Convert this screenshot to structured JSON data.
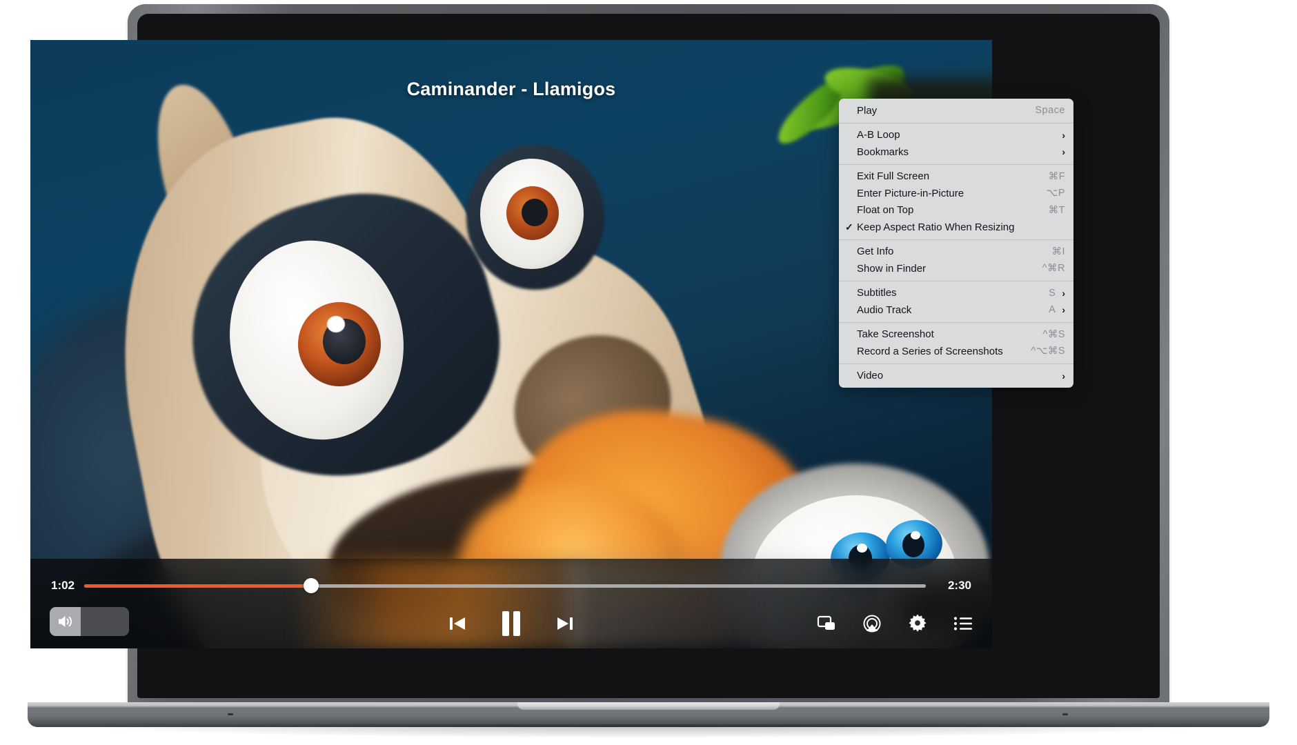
{
  "player": {
    "video_title": "Caminander - Llamigos",
    "current_time": "1:02",
    "duration": "2:30",
    "progress_percent": 27,
    "volume_percent": 39,
    "accent_color": "#f05a28",
    "controls": {
      "volume_icon": "speaker-wave-icon",
      "previous_label": "Previous",
      "play_pause_label": "Pause",
      "next_label": "Next",
      "pip_label": "Picture in Picture",
      "airplay_label": "AirPlay",
      "settings_label": "Settings",
      "playlist_label": "Playlist"
    }
  },
  "context_menu": {
    "groups": [
      [
        {
          "label": "Play",
          "shortcut": "Space",
          "submenu": false,
          "checked": false
        }
      ],
      [
        {
          "label": "A-B Loop",
          "shortcut": "",
          "submenu": true,
          "checked": false
        },
        {
          "label": "Bookmarks",
          "shortcut": "",
          "submenu": true,
          "checked": false
        }
      ],
      [
        {
          "label": "Exit Full Screen",
          "shortcut": "⌘F",
          "submenu": false,
          "checked": false
        },
        {
          "label": "Enter Picture-in-Picture",
          "shortcut": "⌥P",
          "submenu": false,
          "checked": false
        },
        {
          "label": "Float on Top",
          "shortcut": "⌘T",
          "submenu": false,
          "checked": false
        },
        {
          "label": "Keep Aspect Ratio When Resizing",
          "shortcut": "",
          "submenu": false,
          "checked": true
        }
      ],
      [
        {
          "label": "Get Info",
          "shortcut": "⌘I",
          "submenu": false,
          "checked": false
        },
        {
          "label": "Show in Finder",
          "shortcut": "^⌘R",
          "submenu": false,
          "checked": false
        }
      ],
      [
        {
          "label": "Subtitles",
          "shortcut": "S",
          "submenu": true,
          "checked": false
        },
        {
          "label": "Audio Track",
          "shortcut": "A",
          "submenu": true,
          "checked": false
        }
      ],
      [
        {
          "label": "Take Screenshot",
          "shortcut": "^⌘S",
          "submenu": false,
          "checked": false
        },
        {
          "label": "Record a Series of Screenshots",
          "shortcut": "^⌥⌘S",
          "submenu": false,
          "checked": false
        }
      ],
      [
        {
          "label": "Video",
          "shortcut": "",
          "submenu": true,
          "checked": false
        }
      ]
    ],
    "checkmark_glyph": "✓",
    "chevron_glyph": "›"
  }
}
